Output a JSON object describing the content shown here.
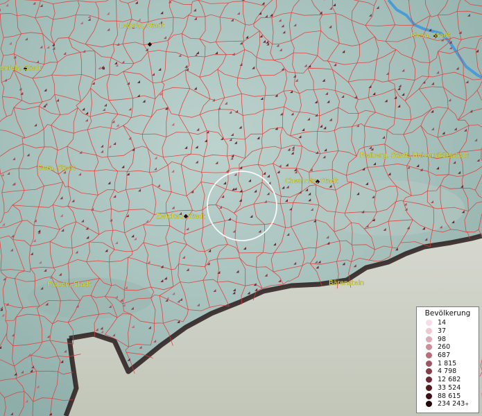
{
  "map": {
    "colors": {
      "water": "#4d9bd6",
      "border": "#e33a35",
      "label_text": "#e6e23a"
    },
    "cities": [
      {
        "name": "Leipzig, Stadt"
      },
      {
        "name": "Riesa, Stadt"
      },
      {
        "name": "enfels, Stadt"
      },
      {
        "name": "Gera, Stadt"
      },
      {
        "name": "Chemnitz, Stadt"
      },
      {
        "name": "Freiberg, Stadt, Universitätsstadt"
      },
      {
        "name": "Zwickau, Stadt"
      },
      {
        "name": "Plauen, Stadt"
      },
      {
        "name": "Bärenstein"
      }
    ]
  },
  "legend": {
    "title": "Bevölkerung",
    "items": [
      {
        "label": "14",
        "color": "#f6dde7"
      },
      {
        "label": "37",
        "color": "#efc8d3"
      },
      {
        "label": "98",
        "color": "#deaab5"
      },
      {
        "label": "260",
        "color": "#cd8d99"
      },
      {
        "label": "687",
        "color": "#b56e7c"
      },
      {
        "label": "1 815",
        "color": "#9c5561"
      },
      {
        "label": "4 798",
        "color": "#843e4a"
      },
      {
        "label": "12 682",
        "color": "#6c2a36"
      },
      {
        "label": "33 524",
        "color": "#551b24"
      },
      {
        "label": "88 615",
        "color": "#3d0f16"
      },
      {
        "label": "234 243",
        "color": "#23060a",
        "suffix": "+"
      }
    ]
  }
}
